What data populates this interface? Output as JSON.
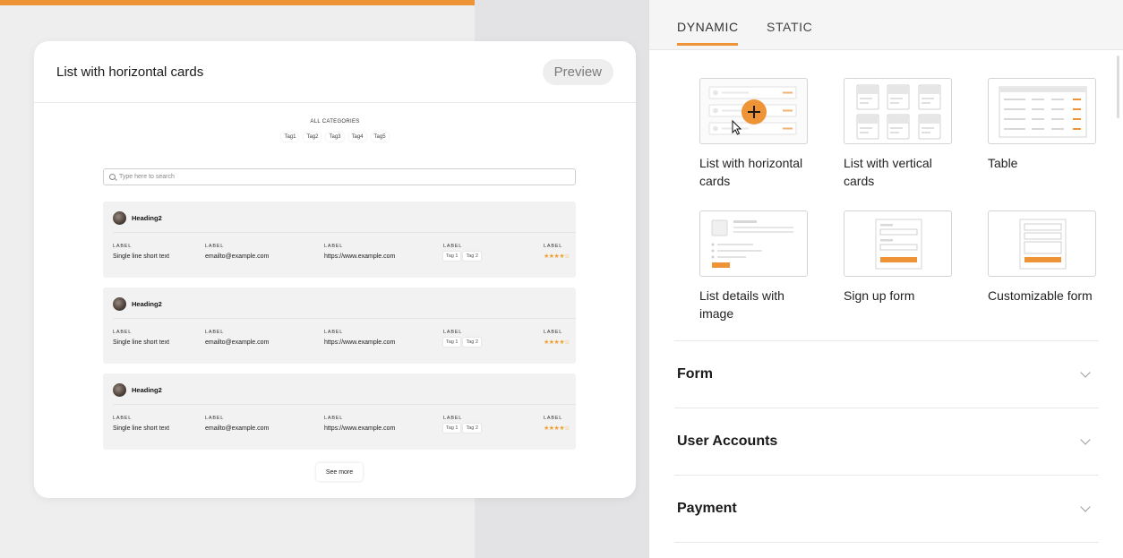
{
  "preview": {
    "title": "List with horizontal cards",
    "preview_button": "Preview",
    "categories_title": "ALL CATEGORIES",
    "category_tags": [
      "Tag1",
      "Tag2",
      "Tag3",
      "Tag4",
      "Tag5"
    ],
    "search_placeholder": "Type here to search",
    "cards": [
      {
        "heading": "Heading2",
        "fields": [
          {
            "label": "LABEL",
            "value": "Single line short text"
          },
          {
            "label": "LABEL",
            "value": "emailto@example.com"
          },
          {
            "label": "LABEL",
            "value": "https://www.example.com"
          },
          {
            "label": "LABEL",
            "tags": [
              "Tag 1",
              "Tag 2"
            ]
          },
          {
            "label": "LABEL",
            "stars": "★★★★☆"
          }
        ]
      },
      {
        "heading": "Heading2",
        "fields": [
          {
            "label": "LABEL",
            "value": "Single line short text"
          },
          {
            "label": "LABEL",
            "value": "emailto@example.com"
          },
          {
            "label": "LABEL",
            "value": "https://www.example.com"
          },
          {
            "label": "LABEL",
            "tags": [
              "Tag 1",
              "Tag 2"
            ]
          },
          {
            "label": "LABEL",
            "stars": "★★★★☆"
          }
        ]
      },
      {
        "heading": "Heading2",
        "fields": [
          {
            "label": "LABEL",
            "value": "Single line short text"
          },
          {
            "label": "LABEL",
            "value": "emailto@example.com"
          },
          {
            "label": "LABEL",
            "value": "https://www.example.com"
          },
          {
            "label": "LABEL",
            "tags": [
              "Tag 1",
              "Tag 2"
            ]
          },
          {
            "label": "LABEL",
            "stars": "★★★★☆"
          }
        ]
      }
    ],
    "see_more": "See more"
  },
  "panel": {
    "tabs": [
      {
        "label": "DYNAMIC",
        "active": true
      },
      {
        "label": "STATIC",
        "active": false
      }
    ],
    "templates": [
      {
        "label": "List with horizontal cards",
        "icon": "horizontal-cards-thumb"
      },
      {
        "label": "List with vertical cards",
        "icon": "vertical-cards-thumb"
      },
      {
        "label": "Table",
        "icon": "table-thumb"
      },
      {
        "label": "List details with image",
        "icon": "list-details-thumb"
      },
      {
        "label": "Sign up form",
        "icon": "signup-form-thumb"
      },
      {
        "label": "Customizable form",
        "icon": "custom-form-thumb"
      }
    ],
    "sections": [
      {
        "title": "Form"
      },
      {
        "title": "User Accounts"
      },
      {
        "title": "Payment"
      }
    ]
  },
  "colors": {
    "accent": "#ef9436",
    "panel_bg": "#ffffff",
    "canvas_bg": "#eeeeee"
  }
}
